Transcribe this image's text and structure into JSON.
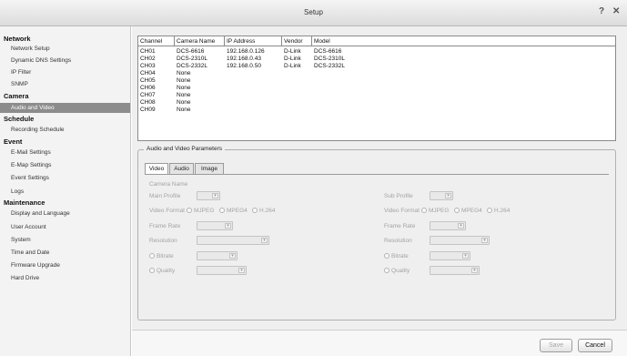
{
  "window": {
    "title": "Setup",
    "help_icon": "?",
    "close_icon": "✕"
  },
  "sidebar": {
    "groups": [
      {
        "label": "Network",
        "items": [
          "Network Setup",
          "Dynamic DNS Settings",
          "IP Filter",
          "SNMP"
        ]
      },
      {
        "label": "Camera",
        "items": [
          "Audio and Video"
        ]
      },
      {
        "label": "Schedule",
        "items": [
          "Recording Schedule"
        ]
      },
      {
        "label": "Event",
        "items": [
          "E-Mail Settings",
          "E-Map Settings",
          "Event Settings",
          "Logs"
        ]
      },
      {
        "label": "Maintenance",
        "items": [
          "Display and Language",
          "User Account",
          "System",
          "Time and Date",
          "Firmware Upgrade",
          "Hard Drive"
        ]
      }
    ],
    "selected": "Audio and Video"
  },
  "channels": {
    "headers": [
      "Channel",
      "Camera Name",
      "IP Address",
      "Vendor",
      "Model"
    ],
    "rows": [
      [
        "CH01",
        "DCS-6616",
        "192.168.0.126",
        "D-Link",
        "DCS-6616"
      ],
      [
        "CH02",
        "DCS-2310L",
        "192.168.0.43",
        "D-Link",
        "DCS-2310L"
      ],
      [
        "CH03",
        "DCS-2332L",
        "192.168.0.50",
        "D-Link",
        "DCS-2332L"
      ],
      [
        "CH04",
        "None",
        "",
        "",
        ""
      ],
      [
        "CH05",
        "None",
        "",
        "",
        ""
      ],
      [
        "CH06",
        "None",
        "",
        "",
        ""
      ],
      [
        "CH07",
        "None",
        "",
        "",
        ""
      ],
      [
        "CH08",
        "None",
        "",
        "",
        ""
      ],
      [
        "CH09",
        "None",
        "",
        "",
        ""
      ]
    ]
  },
  "params": {
    "legend": "Audio and Video Parameters",
    "tabs": [
      "Video",
      "Audio",
      "Image"
    ],
    "active_tab": "Video",
    "camera_name_label": "Camera Name",
    "main": {
      "profile_label": "Main Profile",
      "video_format_label": "Video Format",
      "formats": [
        "MJPEG",
        "MPEG4",
        "H.264"
      ],
      "frame_rate_label": "Frame Rate",
      "resolution_label": "Resolution",
      "bitrate_label": "Bitrate",
      "quality_label": "Quality"
    },
    "sub": {
      "profile_label": "Sub Profile",
      "video_format_label": "Video Format",
      "formats": [
        "MJPEG",
        "MPEG4",
        "H.264"
      ],
      "frame_rate_label": "Frame Rate",
      "resolution_label": "Resolution",
      "bitrate_label": "Bitrate",
      "quality_label": "Quality"
    }
  },
  "footer": {
    "save_label": "Save",
    "cancel_label": "Cancel"
  }
}
